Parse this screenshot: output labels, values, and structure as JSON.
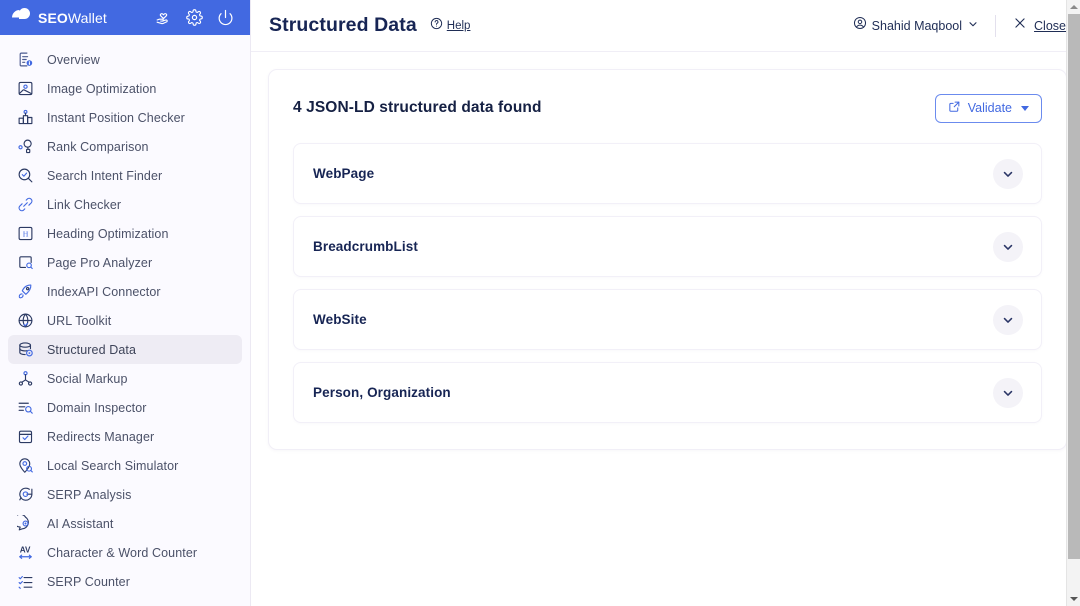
{
  "brand": {
    "name_bold": "SEO",
    "name_light": "Wallet",
    "logo_icon": "pie-logo-icon",
    "header_icons": [
      {
        "name": "heart-hand-icon",
        "title": "Support"
      },
      {
        "name": "gear-icon",
        "title": "Settings"
      },
      {
        "name": "power-icon",
        "title": "Power"
      }
    ]
  },
  "sidebar": {
    "items": [
      {
        "label": "Overview",
        "icon": "document-info-icon",
        "active": false
      },
      {
        "label": "Image Optimization",
        "icon": "image-icon",
        "active": false
      },
      {
        "label": "Instant Position Checker",
        "icon": "podium-icon",
        "active": false
      },
      {
        "label": "Rank Comparison",
        "icon": "nodes-icon",
        "active": false
      },
      {
        "label": "Search Intent Finder",
        "icon": "search-check-icon",
        "active": false
      },
      {
        "label": "Link Checker",
        "icon": "link-icon",
        "active": false
      },
      {
        "label": "Heading Optimization",
        "icon": "heading-h-icon",
        "active": false
      },
      {
        "label": "Page Pro Analyzer",
        "icon": "page-search-icon",
        "active": false
      },
      {
        "label": "IndexAPI Connector",
        "icon": "rocket-icon",
        "active": false
      },
      {
        "label": "URL Toolkit",
        "icon": "globe-check-icon",
        "active": false
      },
      {
        "label": "Structured Data",
        "icon": "database-star-icon",
        "active": true
      },
      {
        "label": "Social Markup",
        "icon": "share-icon",
        "active": false
      },
      {
        "label": "Domain Inspector",
        "icon": "domain-search-icon",
        "active": false
      },
      {
        "label": "Redirects Manager",
        "icon": "calendar-check-icon",
        "active": false
      },
      {
        "label": "Local Search Simulator",
        "icon": "map-pin-search-icon",
        "active": false
      },
      {
        "label": "SERP Analysis",
        "icon": "speech-bubble-icon",
        "active": false
      },
      {
        "label": "AI Assistant",
        "icon": "chat-dot-icon",
        "active": false
      },
      {
        "label": "Character & Word Counter",
        "icon": "av-arrows-icon",
        "active": false
      },
      {
        "label": "SERP Counter",
        "icon": "checklist-icon",
        "active": false
      }
    ]
  },
  "topbar": {
    "title": "Structured Data",
    "help_label": "Help",
    "help_icon": "question-circle-icon",
    "user_name": "Shahid Maqbool",
    "user_icon": "user-circle-icon",
    "user_caret_icon": "chevron-down-icon",
    "close_label": "Close",
    "close_icon": "close-x-icon"
  },
  "main": {
    "card_title": "4 JSON-LD structured data found",
    "validate": {
      "label": "Validate",
      "icon": "external-link-icon",
      "caret_icon": "caret-down-icon"
    },
    "accordions": [
      {
        "label": "WebPage",
        "toggle_icon": "chevron-down-icon"
      },
      {
        "label": "BreadcrumbList",
        "toggle_icon": "chevron-down-icon"
      },
      {
        "label": "WebSite",
        "toggle_icon": "chevron-down-icon"
      },
      {
        "label": "Person, Organization",
        "toggle_icon": "chevron-down-icon"
      }
    ]
  },
  "scrollbar": {
    "up_icon": "scroll-up-arrow-icon",
    "down_icon": "scroll-down-arrow-icon"
  },
  "colors": {
    "brand_blue": "#4269e1",
    "page_bg": "#fbfaff",
    "title_navy": "#172554",
    "active_item_bg": "#eeecf4"
  }
}
